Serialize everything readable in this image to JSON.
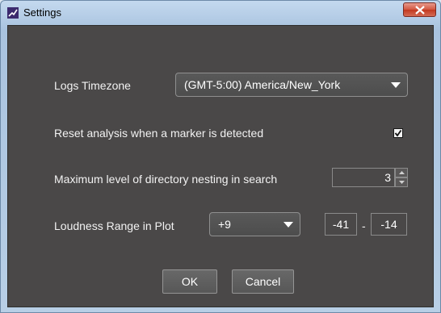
{
  "window": {
    "title": "Settings"
  },
  "settings": {
    "timezone": {
      "label": "Logs Timezone",
      "value": "(GMT-5:00) America/New_York"
    },
    "reset_on_marker": {
      "label": "Reset analysis when a marker is detected",
      "checked": true
    },
    "nesting": {
      "label": "Maximum level of directory nesting in search",
      "value": "3"
    },
    "loudness": {
      "label": "Loudness Range in Plot",
      "preset": "+9",
      "min": "-41",
      "separator": "-",
      "max": "-14"
    }
  },
  "buttons": {
    "ok": "OK",
    "cancel": "Cancel"
  },
  "colors": {
    "panel": "#4a4848",
    "text": "#f2f2f2",
    "close": "#c2381f"
  }
}
